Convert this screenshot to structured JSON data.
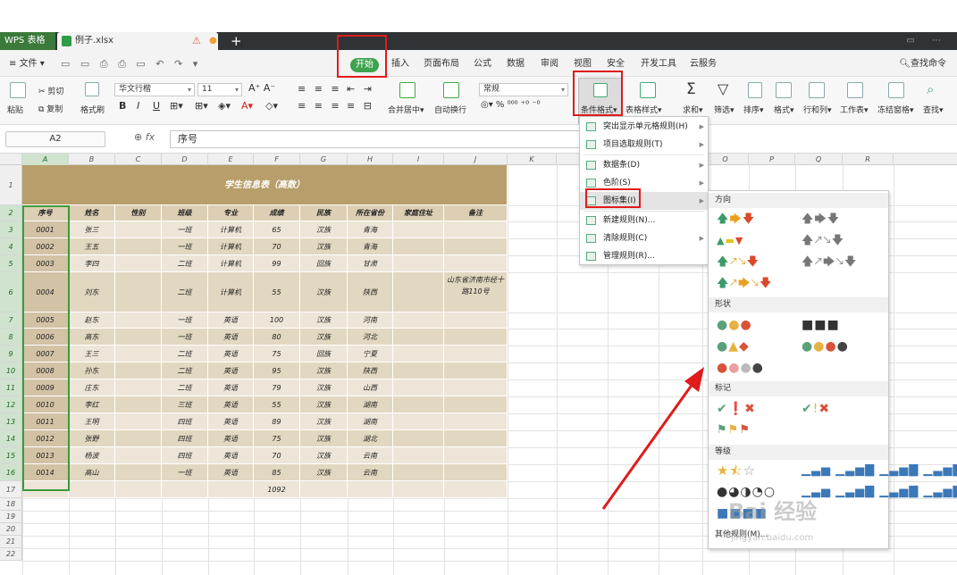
{
  "app": {
    "name": "WPS 表格",
    "file": "例子.xlsx"
  },
  "menu": {
    "file": "文件",
    "tabs": [
      "开始",
      "插入",
      "页面布局",
      "公式",
      "数据",
      "审阅",
      "视图",
      "安全",
      "开发工具",
      "云服务"
    ],
    "search": "查找命令"
  },
  "ribbon": {
    "paste": "粘贴",
    "cut": "剪切",
    "copy": "复制",
    "format_painter": "格式刷",
    "font": "华文行楷",
    "size": "11",
    "merge": "合并居中",
    "wrap": "自动换行",
    "number_format": "常规",
    "cond_format": "条件格式",
    "table_style": "表格样式",
    "sum": "求和",
    "filter": "筛选",
    "sort": "排序",
    "format": "格式",
    "row_col": "行和列",
    "sheet": "工作表",
    "freeze": "冻结窗格",
    "find": "查找"
  },
  "formula": {
    "cell": "A2",
    "fx": "fx",
    "value": "序号"
  },
  "columns": [
    "A",
    "B",
    "C",
    "D",
    "E",
    "F",
    "G",
    "H",
    "I",
    "J",
    "K",
    "L",
    "M",
    "N",
    "O",
    "P",
    "Q",
    "R"
  ],
  "rows": [
    "1",
    "2",
    "3",
    "4",
    "5",
    "6",
    "7",
    "8",
    "9",
    "10",
    "11",
    "12",
    "13",
    "14",
    "15",
    "16",
    "17",
    "18",
    "19",
    "20",
    "21",
    "22"
  ],
  "sheet": {
    "title": "学生信息表（高数）",
    "headers": [
      "序号",
      "姓名",
      "性别",
      "班级",
      "专业",
      "成绩",
      "民族",
      "所在省份",
      "家庭住址",
      "备注"
    ],
    "data": [
      [
        "0001",
        "张三",
        "",
        "一班",
        "计算机",
        "65",
        "汉族",
        "青海",
        "",
        ""
      ],
      [
        "0002",
        "王五",
        "",
        "一班",
        "计算机",
        "70",
        "汉族",
        "青海",
        "",
        ""
      ],
      [
        "0003",
        "李四",
        "",
        "二班",
        "计算机",
        "99",
        "回族",
        "甘肃",
        "",
        ""
      ],
      [
        "0004",
        "刘东",
        "",
        "二班",
        "计算机",
        "55",
        "汉族",
        "陕西",
        "",
        "山东省济南市经十路110号"
      ],
      [
        "0005",
        "赵东",
        "",
        "一班",
        "英语",
        "100",
        "汉族",
        "河南",
        "",
        ""
      ],
      [
        "0006",
        "高东",
        "",
        "一班",
        "英语",
        "80",
        "汉族",
        "河北",
        "",
        ""
      ],
      [
        "0007",
        "王三",
        "",
        "二班",
        "英语",
        "75",
        "回族",
        "宁夏",
        "",
        ""
      ],
      [
        "0008",
        "孙东",
        "",
        "二班",
        "英语",
        "95",
        "汉族",
        "陕西",
        "",
        ""
      ],
      [
        "0009",
        "庄东",
        "",
        "二班",
        "英语",
        "79",
        "汉族",
        "山西",
        "",
        ""
      ],
      [
        "0010",
        "李红",
        "",
        "三班",
        "英语",
        "55",
        "汉族",
        "湖南",
        "",
        ""
      ],
      [
        "0011",
        "王明",
        "",
        "四班",
        "英语",
        "89",
        "汉族",
        "湖南",
        "",
        ""
      ],
      [
        "0012",
        "张野",
        "",
        "四班",
        "英语",
        "75",
        "汉族",
        "湖北",
        "",
        ""
      ],
      [
        "0013",
        "杨波",
        "",
        "四班",
        "英语",
        "70",
        "汉族",
        "云南",
        "",
        ""
      ],
      [
        "0014",
        "高山",
        "",
        "一班",
        "英语",
        "85",
        "汉族",
        "云南",
        "",
        ""
      ]
    ],
    "total": "1092"
  },
  "cf_menu": {
    "items": [
      "突出显示单元格规则(H)",
      "项目选取规则(T)",
      "数据条(D)",
      "色阶(S)",
      "图标集(I)",
      "新建规则(N)...",
      "清除规则(C)",
      "管理规则(R)..."
    ]
  },
  "iconsets": {
    "sections": [
      "方向",
      "形状",
      "标记",
      "等级"
    ],
    "more": "其他规则(M)..."
  },
  "watermark": {
    "text": "Bai 经验",
    "url": "jingyan.baidu.com"
  },
  "colors": {
    "header_band": "#b89e6b",
    "col_head": "#dccfb4",
    "row_light": "#ede6d8",
    "row_dark": "#e2d7c0",
    "accent": "#3fa34d",
    "highlight": "#e01b1b"
  }
}
